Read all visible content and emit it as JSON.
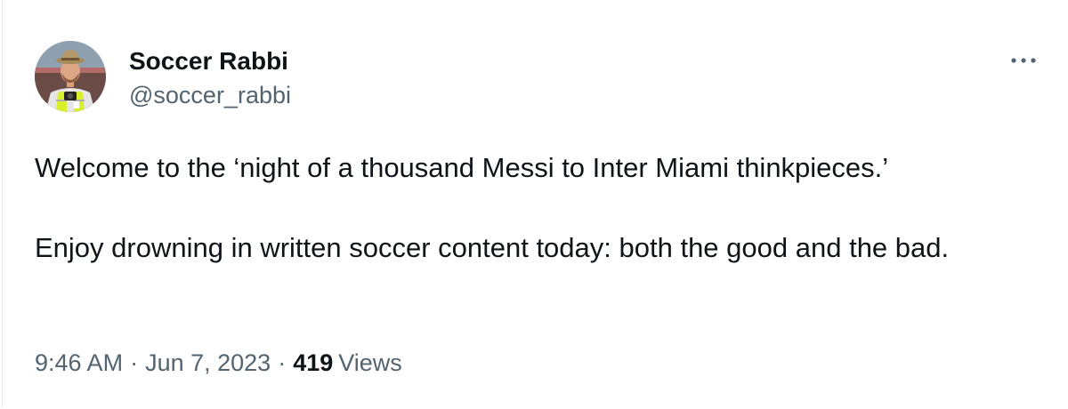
{
  "tweet": {
    "author": {
      "display_name": "Soccer Rabbi",
      "handle": "@soccer_rabbi",
      "avatar_icon": "profile-photo"
    },
    "more_icon": "more-options-icon",
    "text": {
      "paragraph_1": "Welcome to the ‘night of a thousand Messi to Inter Miami thinkpieces.’",
      "paragraph_2": "Enjoy drowning in written soccer content today: both the good and the bad."
    },
    "meta": {
      "time": "9:46 AM",
      "date": "Jun 7, 2023",
      "separator": "·",
      "views_count": "419",
      "views_label": "Views"
    }
  },
  "colors": {
    "text_primary": "#0f1419",
    "text_secondary": "#536471",
    "background": "#ffffff"
  }
}
